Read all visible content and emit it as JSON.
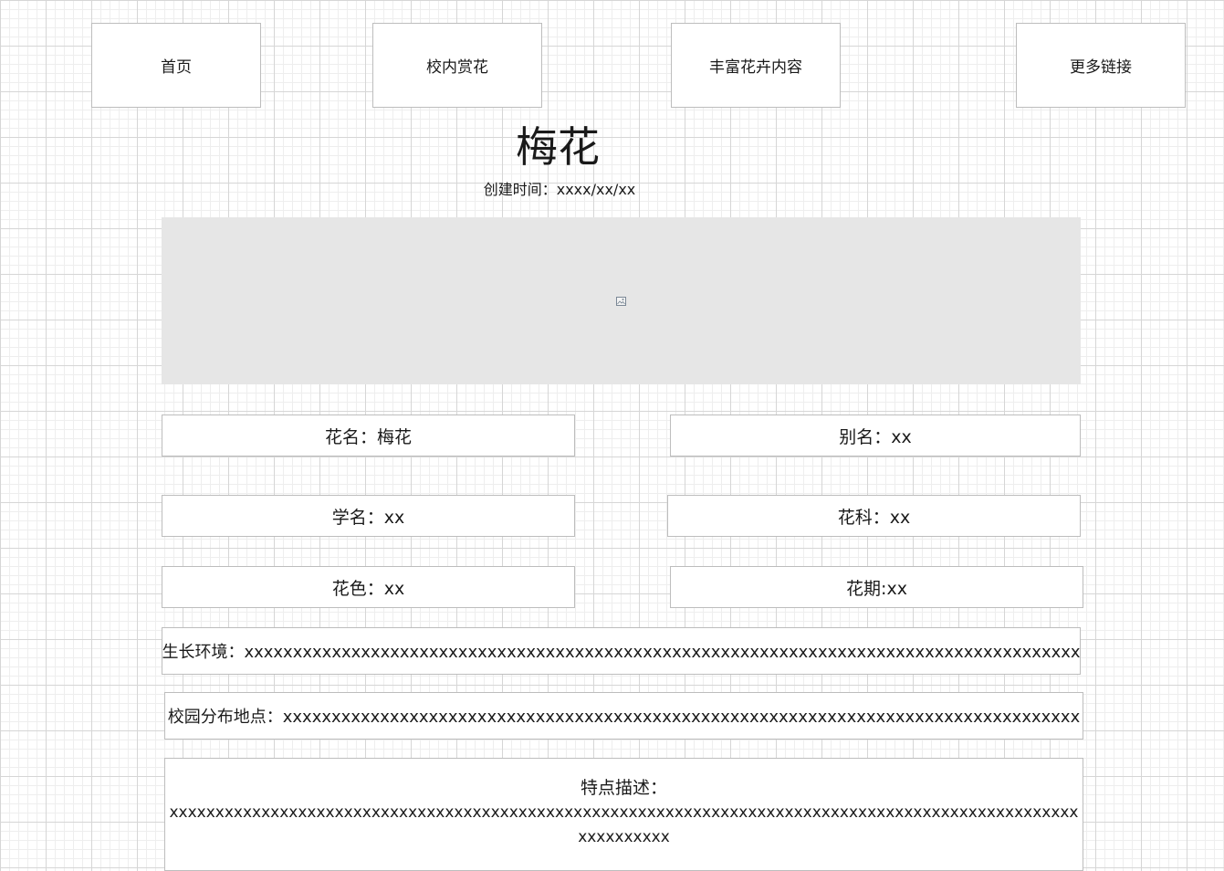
{
  "nav": {
    "home": "首页",
    "campus_flowers": "校内赏花",
    "rich_content": "丰富花卉内容",
    "more_links": "更多链接"
  },
  "page": {
    "title": "梅花",
    "created": "创建时间：xxxx/xx/xx"
  },
  "hero": {
    "icon": "broken-image-icon"
  },
  "fields": {
    "flower_name": "花名：梅花",
    "alias": "别名：xx",
    "scientific_name": "学名：xx",
    "family": "花科：xx",
    "color": "花色：xx",
    "bloom_period": "花期:xx",
    "environment": "生长环境：xxxxxxxxxxxxxxxxxxxxxxxxxxxxxxxxxxxxxxxxxxxxxxxxxxxxxxxxxxxxxxxxxxxxxxxxxxxxxxxxxxxxxx",
    "locations": "校园分布地点：xxxxxxxxxxxxxxxxxxxxxxxxxxxxxxxxxxxxxxxxxxxxxxxxxxxxxxxxxxxxxxxxxxxxxxxxxxxxxxxxxx"
  },
  "description": {
    "label": "特点描述：",
    "text": "xxxxxxxxxxxxxxxxxxxxxxxxxxxxxxxxxxxxxxxxxxxxxxxxxxxxxxxxxxxxxxxxxxxxxxxxxxxxxxxxxxxxxxxxxxxxxxxxxxxxxxxxxxxxx"
  }
}
